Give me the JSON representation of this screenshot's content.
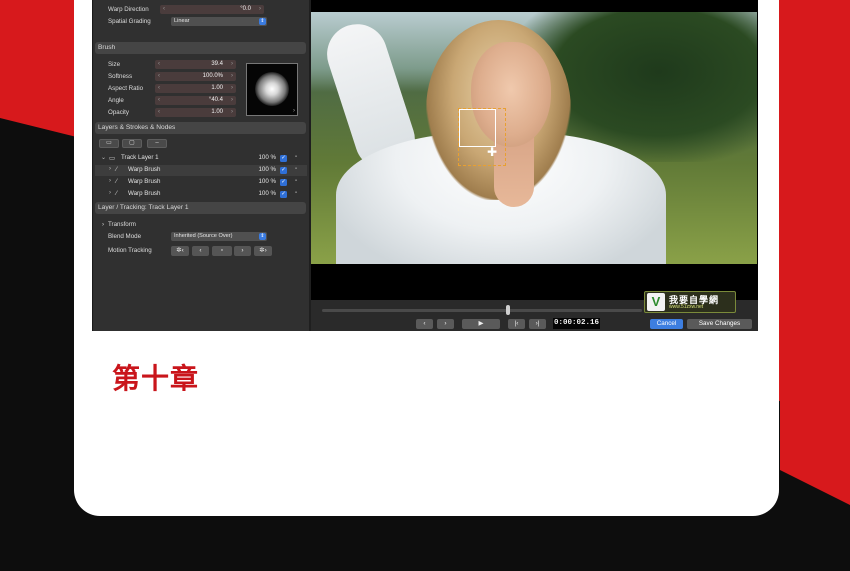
{
  "colors": {
    "poster_red": "#d7191c",
    "poster_black": "#0d0d0d",
    "card": "#ffffff",
    "chapter_text": "#c9151b",
    "accent_blue": "#2f6fd6"
  },
  "top_fields": {
    "warp_direction": {
      "label": "Warp Direction",
      "value": "°0.0"
    },
    "spatial_grading": {
      "label": "Spatial Grading",
      "value": "Linear"
    }
  },
  "brush": {
    "title": "Brush",
    "size": {
      "label": "Size",
      "value": "39.4"
    },
    "softness": {
      "label": "Softness",
      "value": "100.0%"
    },
    "aspect_ratio": {
      "label": "Aspect Ratio",
      "value": "1.00"
    },
    "angle": {
      "label": "Angle",
      "value": "°40.4"
    },
    "opacity": {
      "label": "Opacity",
      "value": "1.00"
    }
  },
  "layers": {
    "title": "Layers & Strokes & Nodes",
    "rows": [
      {
        "name": "Track Layer 1",
        "pct": "100 %",
        "icon": "folder-icon"
      },
      {
        "name": "Warp Brush",
        "pct": "100 %",
        "icon": "brush-icon"
      },
      {
        "name": "Warp Brush",
        "pct": "100 %",
        "icon": "brush-icon"
      },
      {
        "name": "Warp Brush",
        "pct": "100 %",
        "icon": "brush-icon"
      }
    ]
  },
  "tracking": {
    "title": "Layer / Tracking: Track Layer 1",
    "transform_label": "Transform",
    "blend_mode_label": "Blend Mode",
    "blend_mode_value": "Inherited (Source Over)",
    "motion_tracking_label": "Motion Tracking"
  },
  "timeline": {
    "timecode": "0:00:02.16",
    "cancel_label": "Cancel",
    "save_label": "Save Changes"
  },
  "watermark": {
    "title": "我要自學網",
    "url": "www.51zxw.net"
  },
  "chapter_title": "第十章"
}
